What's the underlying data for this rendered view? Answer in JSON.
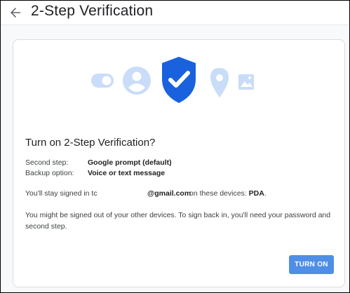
{
  "header": {
    "title": "2-Step Verification",
    "back_icon": "arrow-back-icon"
  },
  "illustration": {
    "icons": [
      "toggle-icon",
      "person-icon",
      "shield-check-icon",
      "location-pin-icon",
      "image-icon"
    ],
    "colors": {
      "light_blue": "#c9dcf8",
      "shield_blue": "#1a62dd"
    }
  },
  "dialog": {
    "title": "Turn on 2-Step Verification?",
    "second_step_label": "Second step:",
    "second_step_value": "Google prompt (default)",
    "backup_label": "Backup option:",
    "backup_value": "Voice or text message",
    "signed_in_prefix": "You'll stay signed in tc",
    "email": "@gmail.com",
    "devices_text": "on these devices:",
    "device": "PDA",
    "device_suffix": ".",
    "note": "You might be signed out of your other devices. To sign back in, you'll need your password and second step.",
    "turn_on_label": "TURN ON"
  },
  "colors": {
    "accent": "#4f8ee6"
  }
}
